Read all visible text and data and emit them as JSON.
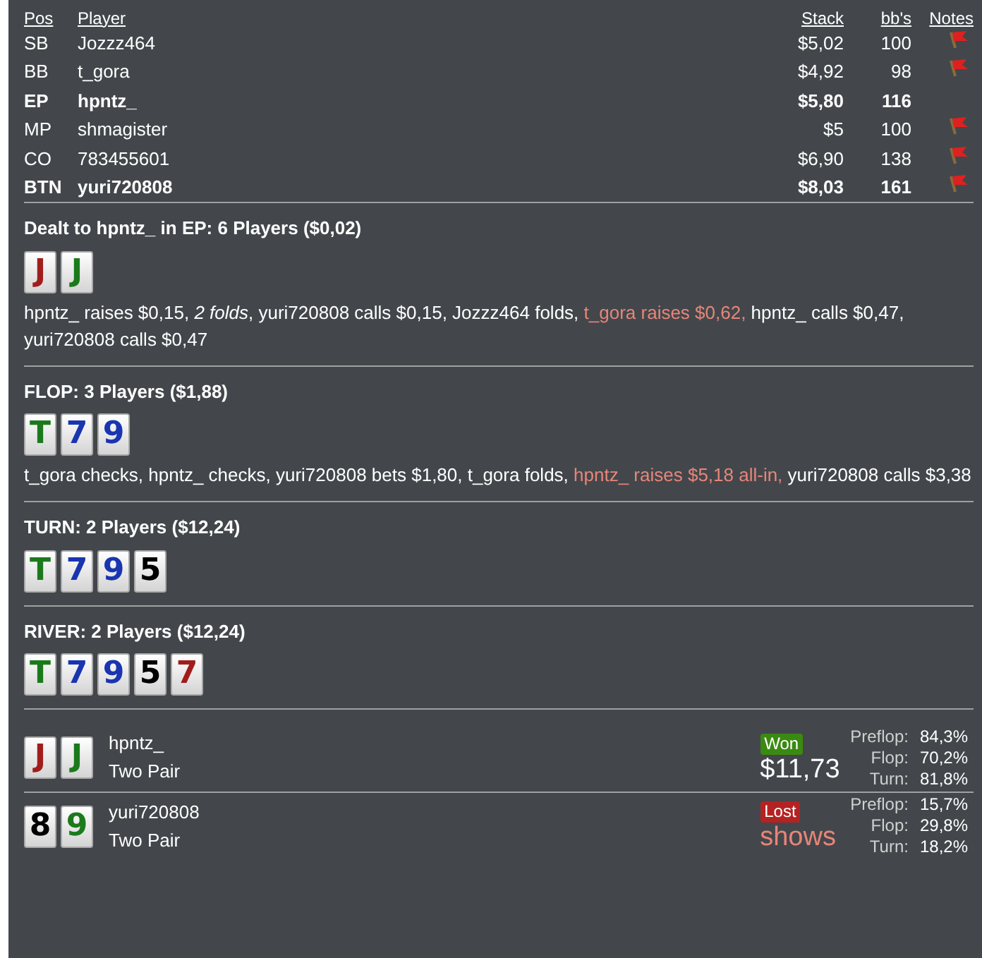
{
  "players": {
    "columns": [
      "Pos",
      "Player",
      "Stack",
      "bb's",
      "Notes"
    ],
    "rows": [
      {
        "pos": "SB",
        "name": "Jozzz464",
        "stack": "$5,02",
        "bbs": "100",
        "hero": false,
        "flag": true
      },
      {
        "pos": "BB",
        "name": "t_gora",
        "stack": "$4,92",
        "bbs": "98",
        "hero": false,
        "flag": true
      },
      {
        "pos": "EP",
        "name": "hpntz_",
        "stack": "$5,80",
        "bbs": "116",
        "hero": true,
        "flag": false
      },
      {
        "pos": "MP",
        "name": "shmagister",
        "stack": "$5",
        "bbs": "100",
        "hero": false,
        "flag": true
      },
      {
        "pos": "CO",
        "name": "783455601",
        "stack": "$6,90",
        "bbs": "138",
        "hero": false,
        "flag": true
      },
      {
        "pos": "BTN",
        "name": "yuri720808",
        "stack": "$8,03",
        "bbs": "161",
        "hero": true,
        "flag": true
      }
    ]
  },
  "streets": [
    {
      "title": "Dealt to hpntz_ in EP: 6 Players ($0,02)",
      "cards": [
        {
          "rank": "J",
          "color": "#a11d1d"
        },
        {
          "rank": "J",
          "color": "#1b7a1b"
        }
      ],
      "actions": [
        {
          "kind": "plain",
          "text": "hpntz_ raises $0,15, "
        },
        {
          "kind": "italic",
          "text": "2 folds"
        },
        {
          "kind": "plain",
          "text": ", yuri720808 calls $0,15, Jozzz464 folds, "
        },
        {
          "kind": "raise",
          "text": "t_gora raises $0,62,"
        },
        {
          "kind": "plain",
          "text": " hpntz_ calls $0,47, yuri720808 calls $0,47"
        }
      ]
    },
    {
      "title": "FLOP: 3 Players ($1,88)",
      "cards": [
        {
          "rank": "T",
          "color": "#1b7a1b"
        },
        {
          "rank": "7",
          "color": "#1a35b0"
        },
        {
          "rank": "9",
          "color": "#1a35b0"
        }
      ],
      "actions": [
        {
          "kind": "plain",
          "text": "t_gora checks, hpntz_ checks, yuri720808 bets $1,80, t_gora folds, "
        },
        {
          "kind": "raise",
          "text": "hpntz_ raises $5,18 all-in,"
        },
        {
          "kind": "plain",
          "text": " yuri720808 calls $3,38"
        }
      ]
    },
    {
      "title": "TURN: 2 Players ($12,24)",
      "cards": [
        {
          "rank": "T",
          "color": "#1b7a1b"
        },
        {
          "rank": "7",
          "color": "#1a35b0"
        },
        {
          "rank": "9",
          "color": "#1a35b0"
        },
        {
          "rank": "5",
          "color": "#000000"
        }
      ]
    },
    {
      "title": "RIVER: 2 Players ($12,24)",
      "cards": [
        {
          "rank": "T",
          "color": "#1b7a1b"
        },
        {
          "rank": "7",
          "color": "#1a35b0"
        },
        {
          "rank": "9",
          "color": "#1a35b0"
        },
        {
          "rank": "5",
          "color": "#000000"
        },
        {
          "rank": "7",
          "color": "#a11d1d"
        }
      ]
    }
  ],
  "results": [
    {
      "cards": [
        {
          "rank": "J",
          "color": "#a11d1d"
        },
        {
          "rank": "J",
          "color": "#1b7a1b"
        }
      ],
      "name": "hpntz_",
      "hand": "Two Pair",
      "kind": "won",
      "badge": "Won",
      "amount": "$11,73",
      "equity": [
        {
          "label": "Preflop:",
          "value": "84,3%"
        },
        {
          "label": "Flop:",
          "value": "70,2%"
        },
        {
          "label": "Turn:",
          "value": "81,8%"
        }
      ]
    },
    {
      "cards": [
        {
          "rank": "8",
          "color": "#000000"
        },
        {
          "rank": "9",
          "color": "#1b7a1b"
        }
      ],
      "name": "yuri720808",
      "hand": "Two Pair",
      "kind": "lost",
      "badge": "Lost",
      "amount": "shows",
      "equity": [
        {
          "label": "Preflop:",
          "value": "15,7%"
        },
        {
          "label": "Flop:",
          "value": "29,8%"
        },
        {
          "label": "Turn:",
          "value": "18,2%"
        }
      ]
    }
  ]
}
